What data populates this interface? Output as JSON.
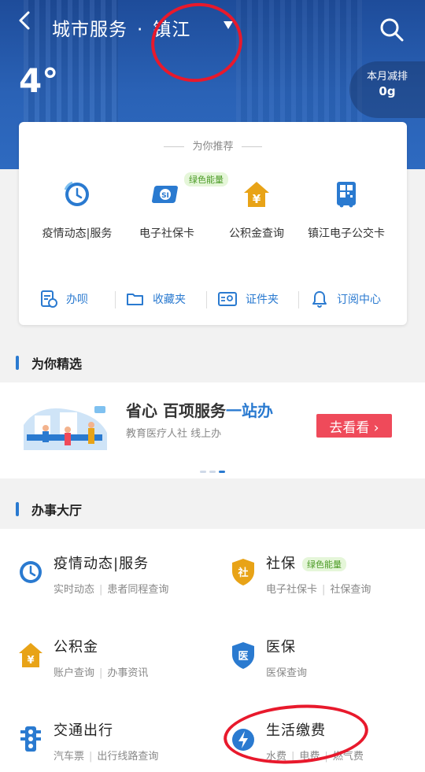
{
  "header": {
    "title": "城市服务",
    "separator": "·",
    "city": "镇江",
    "temperature": "4°",
    "carbon_label": "本月减排",
    "carbon_value": "0g"
  },
  "recommend": {
    "title": "为你推荐",
    "items": [
      {
        "label": "疫情动态|服务",
        "icon": "clock-icon"
      },
      {
        "label": "电子社保卡",
        "icon": "social-card-icon",
        "badge": "绿色能量"
      },
      {
        "label": "公积金查询",
        "icon": "house-yuan-icon"
      },
      {
        "label": "镇江电子公交卡",
        "icon": "bus-qr-icon"
      }
    ],
    "quick": [
      {
        "label": "办呗",
        "icon": "document-clock-icon"
      },
      {
        "label": "收藏夹",
        "icon": "folder-icon"
      },
      {
        "label": "证件夹",
        "icon": "id-card-icon"
      },
      {
        "label": "订阅中心",
        "icon": "bell-icon"
      }
    ]
  },
  "featured": {
    "title": "为你精选",
    "headline_a": "省心 百项服务",
    "headline_b": "一站办",
    "subtitle": "教育医疗人社 线上办",
    "button": "去看看 ›"
  },
  "hall": {
    "title": "办事大厅",
    "services": [
      {
        "name": "疫情动态|服务",
        "d1": "实时动态",
        "d2": "患者同程查询",
        "icon": "clock-icon",
        "color": "#2a7ad0"
      },
      {
        "name": "社保",
        "tag": "绿色能量",
        "d1": "电子社保卡",
        "d2": "社保查询",
        "icon": "shield-she-icon",
        "color": "#e8a317"
      },
      {
        "name": "公积金",
        "d1": "账户查询",
        "d2": "办事资讯",
        "icon": "house-yuan-icon",
        "color": "#e8a317"
      },
      {
        "name": "医保",
        "d1": "医保查询",
        "d2": "",
        "icon": "shield-yi-icon",
        "color": "#2a7ad0"
      },
      {
        "name": "交通出行",
        "d1": "汽车票",
        "d2": "出行线路查询",
        "icon": "traffic-light-icon",
        "color": "#2a7ad0"
      },
      {
        "name": "生活缴费",
        "d1": "水费",
        "d2": "电费",
        "d3": "燃气费",
        "icon": "lightning-icon",
        "color": "#2a7ad0"
      }
    ]
  },
  "colors": {
    "accent": "#2a7ad0",
    "orange": "#e8a317",
    "red": "#ef4a5a",
    "green_badge": "#4a9a25"
  }
}
